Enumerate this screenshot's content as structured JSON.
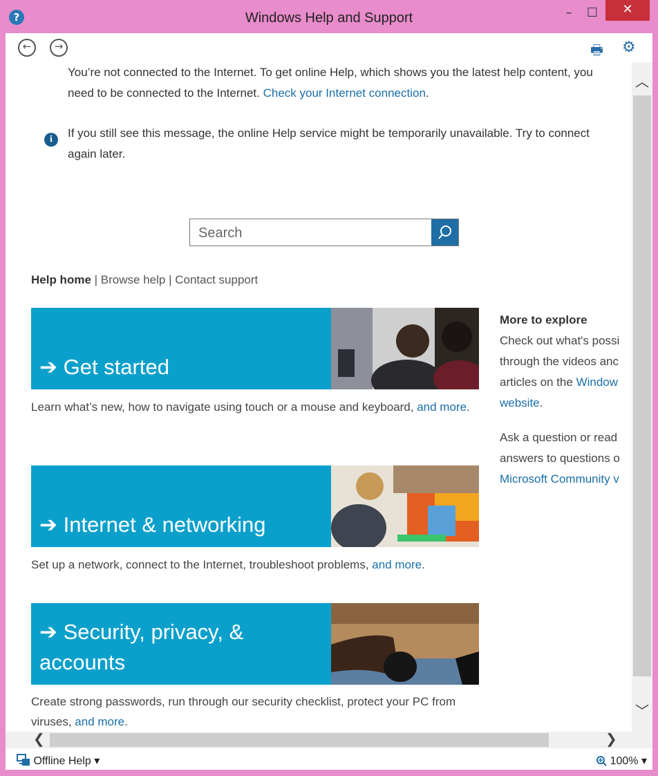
{
  "window": {
    "title": "Windows Help and Support",
    "help_glyph": "?",
    "min": "–",
    "max": "☐",
    "close": "✕"
  },
  "toolbar": {
    "back_glyph": "←",
    "forward_glyph": "→",
    "print_glyph": "🖶",
    "settings_glyph": "⚙"
  },
  "notice": {
    "line1_text": "You’re not connected to the Internet. To get online Help, which shows you the latest help content, you need to be connected to the Internet. ",
    "line1_link": "Check your Internet connection",
    "line1_end": ".",
    "line2": "If you still see this message, the online Help service might be temporarily unavailable. Try to connect again later."
  },
  "search": {
    "placeholder": "Search"
  },
  "crumbs": {
    "home": "Help home",
    "sep": " | ",
    "browse": "Browse help",
    "contact": "Contact support"
  },
  "tiles": [
    {
      "title": "➔ Get started",
      "desc": "Learn what’s new, how to navigate using touch or a mouse and keyboard, ",
      "more": "and more",
      "end": "."
    },
    {
      "title": "➔ Internet & networking",
      "desc": "Set up a network, connect to the Internet, troubleshoot problems, ",
      "more": "and more",
      "end": "."
    },
    {
      "title": "➔ Security, privacy, & accounts",
      "desc": "Create strong passwords, run through our security checklist, protect your PC from viruses, ",
      "more": "and more",
      "end": "."
    }
  ],
  "side": {
    "heading": "More to explore",
    "p1_l1": "Check out what's possi",
    "p1_l2": "through the videos anc",
    "p1_l3": "articles on the ",
    "p1_link1": "Window",
    "p1_link2": "website",
    "p1_end": ".",
    "p2_l1": "Ask a question or read",
    "p2_l2": "answers to questions o",
    "p2_link": "Microsoft Community v"
  },
  "scroll": {
    "up": "︿",
    "down": "﹀",
    "left": "❮",
    "right": "❯"
  },
  "status": {
    "offline_label": "Offline Help ▾",
    "zoom_label": "100% ▾"
  },
  "colors": {
    "accent": "#0ba0cc",
    "link": "#1a6fa8",
    "frame": "#e88ccb",
    "close": "#c7303a"
  }
}
